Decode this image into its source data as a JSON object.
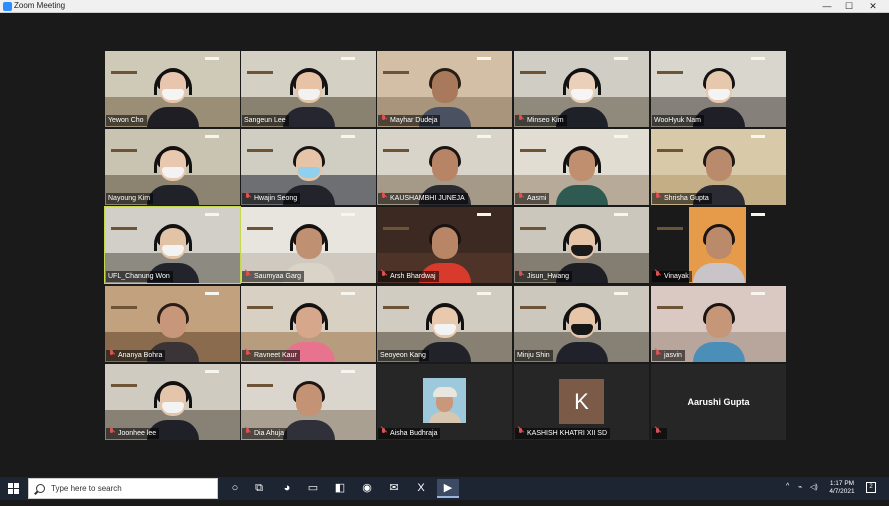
{
  "window": {
    "title": "Zoom Meeting",
    "controls": {
      "minimize": "—",
      "maximize": "☐",
      "close": "✕"
    }
  },
  "participants": [
    {
      "name": "Yewon Cho",
      "muted": false,
      "type": "video",
      "skin": "#e7c6ad",
      "hair": "#161313",
      "mask": "#f4f4f4",
      "headset": true,
      "torso": "#1e1e24",
      "wall": "#cfcab8",
      "floor": "#9b8e76"
    },
    {
      "name": "Sangeun Lee",
      "muted": false,
      "type": "video",
      "skin": "#e6c2a6",
      "hair": "#1a1514",
      "mask": "#f2f2f2",
      "headset": true,
      "torso": "#262630",
      "wall": "#d4d0c3",
      "floor": "#8a8270"
    },
    {
      "name": "Mayhar Dudeja",
      "muted": true,
      "type": "video",
      "skin": "#a87a5b",
      "hair": "#2a1d16",
      "mask": "",
      "headset": false,
      "torso": "#4a5160",
      "wall": "#d3bfa6",
      "floor": "#a9947c"
    },
    {
      "name": "Minseo Kim",
      "muted": true,
      "type": "video",
      "skin": "#ead0b8",
      "hair": "#171414",
      "mask": "#f5f5f5",
      "headset": true,
      "torso": "#1f2128",
      "wall": "#cfcdc4",
      "floor": "#8f8a7c"
    },
    {
      "name": "WooHyuk Nam",
      "muted": false,
      "type": "video",
      "skin": "#e6c8ad",
      "hair": "#141212",
      "mask": "#f4f4f4",
      "headset": false,
      "torso": "#1e1f27",
      "wall": "#d8d6cd",
      "floor": "#85807a"
    },
    {
      "name": "Nayoung Kim",
      "muted": false,
      "type": "video",
      "skin": "#e8c8ae",
      "hair": "#151212",
      "mask": "#f3f3f3",
      "headset": true,
      "torso": "#212229",
      "wall": "#c9c3b1",
      "floor": "#8c8370"
    },
    {
      "name": "Hwajin Seong",
      "muted": true,
      "type": "video",
      "skin": "#e6c4a8",
      "hair": "#181413",
      "mask": "#8fd0ee",
      "headset": false,
      "torso": "#22232b",
      "wall": "#d0cdc2",
      "floor": "#6d6f73"
    },
    {
      "name": "KAUSHAMBHI JUNEJA",
      "muted": true,
      "type": "video",
      "skin": "#b78466",
      "hair": "#1b1412",
      "mask": "",
      "headset": false,
      "torso": "#2a2a30",
      "wall": "#d8d4c9",
      "floor": "#a59a88"
    },
    {
      "name": "Aasmi",
      "muted": true,
      "type": "video",
      "skin": "#c08f70",
      "hair": "#1c1512",
      "mask": "",
      "headset": true,
      "torso": "#2e5a52",
      "wall": "#e2ddd3",
      "floor": "#b8aa99"
    },
    {
      "name": "Shrisha Gupta",
      "muted": true,
      "type": "video",
      "skin": "#b98a6c",
      "hair": "#1f1714",
      "mask": "",
      "headset": false,
      "torso": "#2b2b33",
      "wall": "#d8c9a8",
      "floor": "#c4ae86"
    },
    {
      "name": "UFL_Chanung Won",
      "muted": false,
      "type": "video",
      "skin": "#e3c3a6",
      "hair": "#141212",
      "mask": "#f3f3f3",
      "headset": true,
      "torso": "#23242b",
      "wall": "#d1cfc8",
      "floor": "#8d8a82",
      "active": true
    },
    {
      "name": "Saumyaa Garg",
      "muted": true,
      "type": "video",
      "skin": "#c09072",
      "hair": "#1d1512",
      "mask": "",
      "headset": true,
      "torso": "#d9d3c8",
      "wall": "#e8e5df",
      "floor": "#cfc9bf"
    },
    {
      "name": "Arsh Bhardwaj",
      "muted": true,
      "type": "video",
      "skin": "#b88567",
      "hair": "#1a1311",
      "mask": "",
      "headset": false,
      "torso": "#d83b2c",
      "wall": "#3c2a22",
      "floor": "#4d3328"
    },
    {
      "name": "Jisun_Hwang",
      "muted": true,
      "type": "video",
      "skin": "#e5c4a8",
      "hair": "#171313",
      "mask": "#1a1a1a",
      "headset": true,
      "torso": "#1e1f25",
      "wall": "#cbc7bc",
      "floor": "#847e72"
    },
    {
      "name": "Vinayak",
      "muted": true,
      "type": "video",
      "skin": "#bb8a6a",
      "hair": "#1b1411",
      "mask": "",
      "headset": false,
      "torso": "#c9c4c7",
      "wall": "#e59b4a",
      "floor": "#d88b3c",
      "narrow": true
    },
    {
      "name": "Ananya Bohra",
      "muted": true,
      "type": "video",
      "skin": "#c8977a",
      "hair": "#2a1c16",
      "mask": "",
      "headset": false,
      "torso": "#3a3436",
      "wall": "#c2a17f",
      "floor": "#8a6b4e"
    },
    {
      "name": "Ravneet Kaur",
      "muted": true,
      "type": "video",
      "skin": "#d6a78b",
      "hair": "#1f1513",
      "mask": "",
      "headset": true,
      "torso": "#e8738e",
      "wall": "#d9d0c4",
      "floor": "#b79d7e"
    },
    {
      "name": "Seoyeon Kang",
      "muted": false,
      "type": "video",
      "skin": "#e8c9ae",
      "hair": "#161313",
      "mask": "#f3f3f3",
      "headset": true,
      "torso": "#22232a",
      "wall": "#d0ccc1",
      "floor": "#878073"
    },
    {
      "name": "Minju Shin",
      "muted": false,
      "type": "video",
      "skin": "#e6c5a9",
      "hair": "#171313",
      "mask": "#161616",
      "headset": true,
      "torso": "#20212a",
      "wall": "#cdc8bd",
      "floor": "#878074"
    },
    {
      "name": "jasvin",
      "muted": true,
      "type": "video",
      "skin": "#c69679",
      "hair": "#1c1412",
      "mask": "",
      "headset": false,
      "torso": "#4b8fb8",
      "wall": "#d9c9c2",
      "floor": "#b8a59c"
    },
    {
      "name": "Joonhee lee",
      "muted": true,
      "type": "video",
      "skin": "#e5c5aa",
      "hair": "#161313",
      "mask": "#f3f3f3",
      "headset": true,
      "torso": "#1f2028",
      "wall": "#cfcbc1",
      "floor": "#888175"
    },
    {
      "name": "Dia Ahuja",
      "muted": true,
      "type": "video",
      "skin": "#c49274",
      "hair": "#1e1512",
      "mask": "",
      "headset": false,
      "torso": "#30303a",
      "wall": "#dad6ce",
      "floor": "#a9a091"
    },
    {
      "name": "Aisha Budhraja",
      "muted": true,
      "type": "photo",
      "photo_bg": "#9ec9dc"
    },
    {
      "name": "KASHISH KHATRI XII SD",
      "muted": true,
      "type": "initial",
      "initial": "K",
      "avatar_color": "#7b5a48"
    },
    {
      "name": "Aarushi Gupta",
      "muted": true,
      "type": "name-only"
    }
  ],
  "taskbar": {
    "search_placeholder": "Type here to search",
    "pinned": [
      {
        "name": "task-view-icon",
        "glyph": "○"
      },
      {
        "name": "task-switch-icon",
        "glyph": "⧉"
      },
      {
        "name": "edge-icon",
        "glyph": "◕"
      },
      {
        "name": "file-explorer-icon",
        "glyph": "▭"
      },
      {
        "name": "store-icon",
        "glyph": "◧"
      },
      {
        "name": "chrome-icon",
        "glyph": "◉"
      },
      {
        "name": "mail-icon",
        "glyph": "✉"
      },
      {
        "name": "excel-icon",
        "glyph": "X"
      },
      {
        "name": "zoom-icon",
        "glyph": "▶"
      }
    ],
    "tray": {
      "chevron": "^",
      "network": "⌁",
      "volume": "◁)"
    },
    "time": "1:17 PM",
    "date": "4/7/2021",
    "notifications": "2"
  },
  "colors": {
    "active_speaker_border": "#c5d74a",
    "muted_icon": "#e05050",
    "taskbar_bg": "#1d2533"
  }
}
